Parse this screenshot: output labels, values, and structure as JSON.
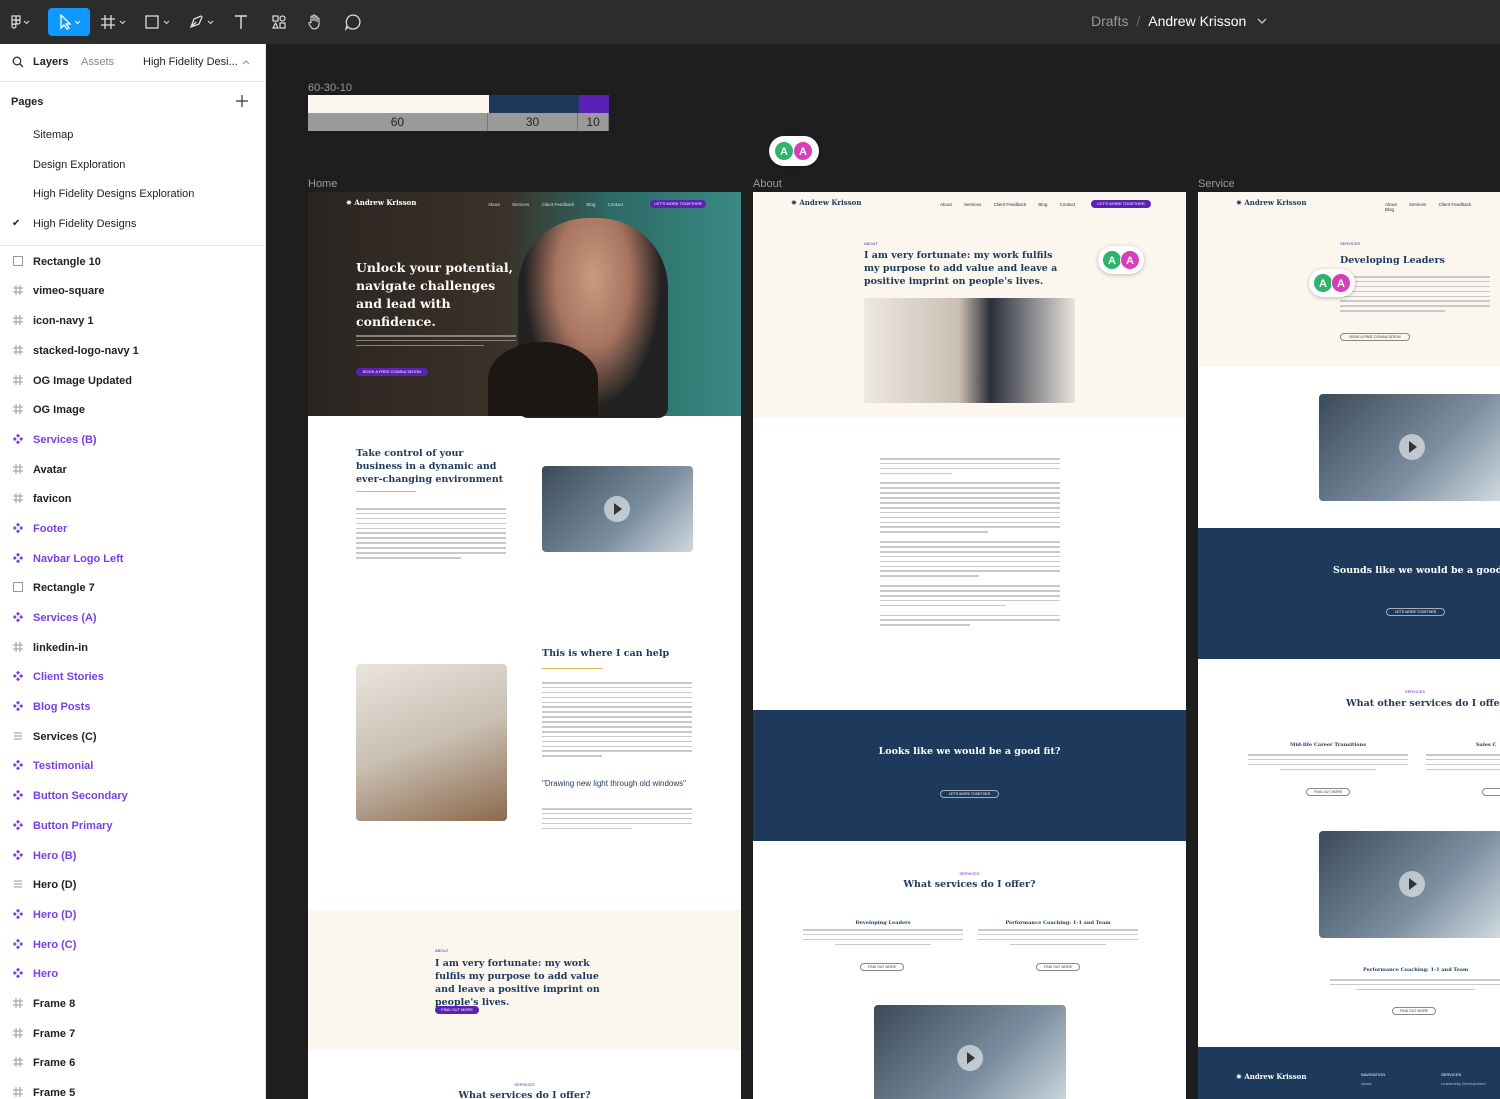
{
  "toolbar": {
    "tools": [
      "main-menu",
      "move",
      "frame",
      "shape",
      "pen",
      "text",
      "resources",
      "hand",
      "comment"
    ]
  },
  "breadcrumb": {
    "folder": "Drafts",
    "separator": "/",
    "file": "Andrew Krisson"
  },
  "sidebar": {
    "tabs": {
      "layers": "Layers",
      "assets": "Assets",
      "page_switch": "High Fidelity Desi..."
    },
    "pages_title": "Pages",
    "pages": [
      "Sitemap",
      "Design Exploration",
      "High Fidelity Designs Exploration",
      "High Fidelity Designs"
    ],
    "current_page_check": "✔",
    "layers": [
      {
        "name": "Rectangle 10",
        "kind": "rect"
      },
      {
        "name": "vimeo-square",
        "kind": "frame"
      },
      {
        "name": "icon-navy 1",
        "kind": "frame"
      },
      {
        "name": "stacked-logo-navy 1",
        "kind": "frame"
      },
      {
        "name": "OG Image Updated",
        "kind": "frame"
      },
      {
        "name": "OG Image",
        "kind": "frame"
      },
      {
        "name": "Services (B)",
        "kind": "component"
      },
      {
        "name": "Avatar",
        "kind": "frame"
      },
      {
        "name": "favicon",
        "kind": "frame"
      },
      {
        "name": "Footer",
        "kind": "component"
      },
      {
        "name": "Navbar Logo Left",
        "kind": "component"
      },
      {
        "name": "Rectangle 7",
        "kind": "rect"
      },
      {
        "name": "Services (A)",
        "kind": "component"
      },
      {
        "name": "linkedin-in",
        "kind": "frame"
      },
      {
        "name": "Client Stories",
        "kind": "component"
      },
      {
        "name": "Blog Posts",
        "kind": "component"
      },
      {
        "name": "Services (C)",
        "kind": "list"
      },
      {
        "name": "Testimonial",
        "kind": "component"
      },
      {
        "name": "Button Secondary",
        "kind": "component"
      },
      {
        "name": "Button Primary",
        "kind": "component"
      },
      {
        "name": "Hero (B)",
        "kind": "component"
      },
      {
        "name": "Hero (D)",
        "kind": "list"
      },
      {
        "name": "Hero (D)",
        "kind": "component"
      },
      {
        "name": "Hero (C)",
        "kind": "component"
      },
      {
        "name": "Hero",
        "kind": "component"
      },
      {
        "name": "Frame 8",
        "kind": "frame"
      },
      {
        "name": "Frame 7",
        "kind": "frame"
      },
      {
        "name": "Frame 6",
        "kind": "frame"
      },
      {
        "name": "Frame 5",
        "kind": "frame"
      }
    ]
  },
  "canvas": {
    "ratio": {
      "label": "60-30-10",
      "values": [
        "60",
        "30",
        "10"
      ],
      "colors": [
        "#fbf6ee",
        "#1d3a5c",
        "#5b21b6"
      ]
    },
    "avatars": [
      "A",
      "A"
    ],
    "frames": {
      "home": {
        "label": "Home",
        "logo": "Andrew Krisson",
        "logo_sub": "Leadership & Performance Coach",
        "nav": [
          "About",
          "Services",
          "Client Feedback",
          "Blog",
          "Contact"
        ],
        "nav_cta": "LET'S WORK TOGETHER",
        "hero_title": "Unlock your potential, navigate challenges and lead with confidence.",
        "hero_cta": "BOOK A FREE CONSULTATION",
        "section1_title": "Take control of your business in a dynamic and ever-changing environment",
        "section2_title": "This is where I can help",
        "quote": "\"Drawing new light through old windows\"",
        "about_kicker": "ABOUT",
        "about_title": "I am very fortunate: my work fulfils my purpose to add value and leave a positive imprint on people's lives.",
        "about_cta": "FIND OUT MORE",
        "services_kicker": "SERVICES",
        "services_title": "What services do I offer?"
      },
      "about": {
        "label": "About",
        "kicker": "ABOUT",
        "title": "I am very fortunate: my work fulfils my purpose to add value and leave a positive imprint on people's lives.",
        "cta_title": "Looks like we would be a good fit?",
        "cta_btn": "LET'S WORK TOGETHER",
        "services_kicker": "SERVICES",
        "services_title": "What services do I offer?",
        "svc1": "Developing Leaders",
        "svc2": "Performance Coaching: 1-1 and Team",
        "find_out": "FIND OUT MORE"
      },
      "service": {
        "label": "Service",
        "kicker": "SERVICES",
        "title": "Developing Leaders",
        "cta_title": "Sounds like we would be a good fit?",
        "cta_btn": "LET'S WORK TOGETHER",
        "other_kicker": "SERVICES",
        "other_title": "What other services do I offer?",
        "svc1": "Mid-life Career Transitions",
        "svc2": "Sales C",
        "svc3": "Performance Coaching: 1-1 and Team",
        "find_out": "FIND OUT MORE",
        "footer_logo": "Andrew Krisson",
        "footer_col1": "NAVIGATION",
        "footer_col2": "SERVICES",
        "footer_about": "About",
        "footer_ld": "Leadership Development"
      }
    }
  }
}
